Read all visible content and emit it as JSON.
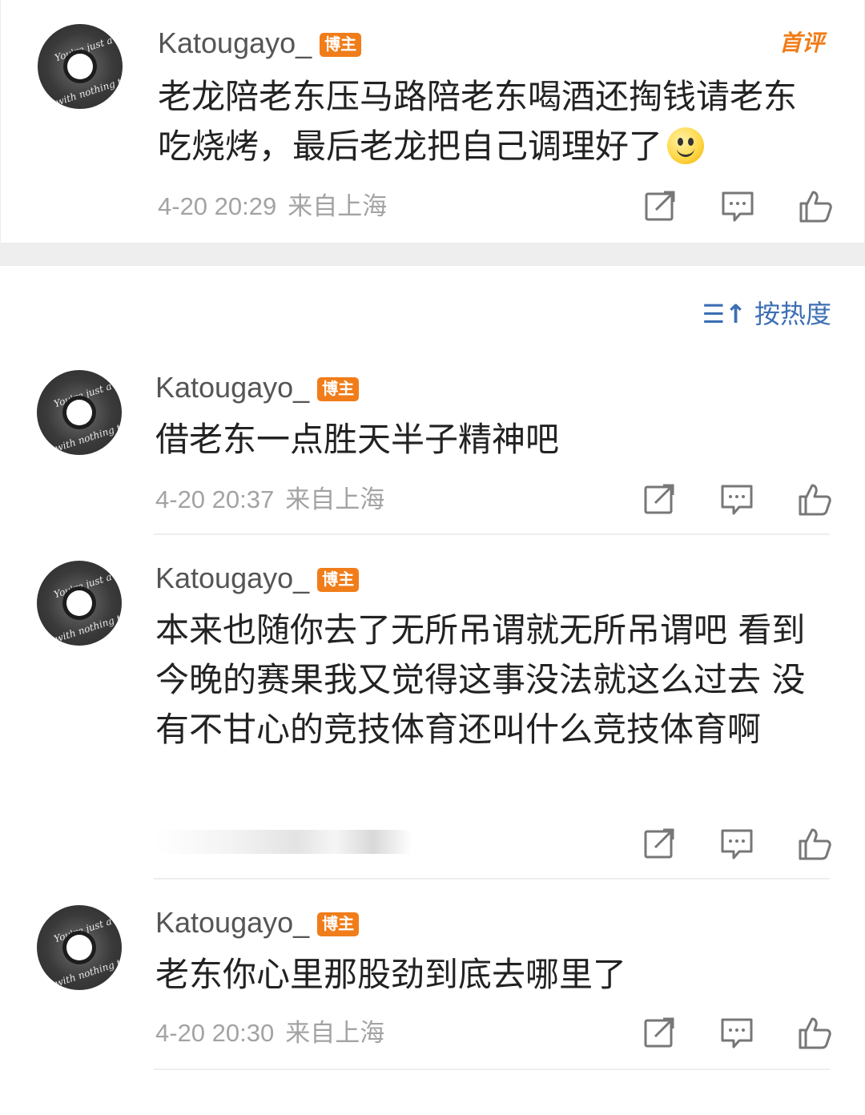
{
  "first_comment": {
    "tag": "首评",
    "username": "Katougayo_",
    "badge": "博主",
    "text": "老龙陪老东压马路陪老东喝酒还掏钱请老东吃烧烤，最后老龙把自己调理好了",
    "date": "4-20 20:29",
    "location": "来自上海",
    "avatar_text_top": "You're just a SAD SONG",
    "avatar_text_bottom": "with nothing to say"
  },
  "sort": {
    "icon": "sort-icon",
    "label": "按热度"
  },
  "comments": [
    {
      "username": "Katougayo_",
      "badge": "博主",
      "text": "借老东一点胜天半子精神吧",
      "date": "4-20 20:37",
      "location": "来自上海"
    },
    {
      "username": "Katougayo_",
      "badge": "博主",
      "text": "本来也随你去了无所吊谓就无所吊谓吧 看到今晚的赛果我又觉得这事没法就这么过去 没有不甘心的竞技体育还叫什么竞技体育啊",
      "date": "",
      "location": ""
    },
    {
      "username": "Katougayo_",
      "badge": "博主",
      "text": "老东你心里那股劲到底去哪里了",
      "date": "4-20 20:30",
      "location": "来自上海"
    }
  ],
  "colors": {
    "badge": "#f07d1a",
    "link": "#3d6fb3",
    "meta": "#a3a3a3",
    "text": "#222222"
  },
  "action_icons": [
    "share-icon",
    "comment-icon",
    "like-icon"
  ]
}
